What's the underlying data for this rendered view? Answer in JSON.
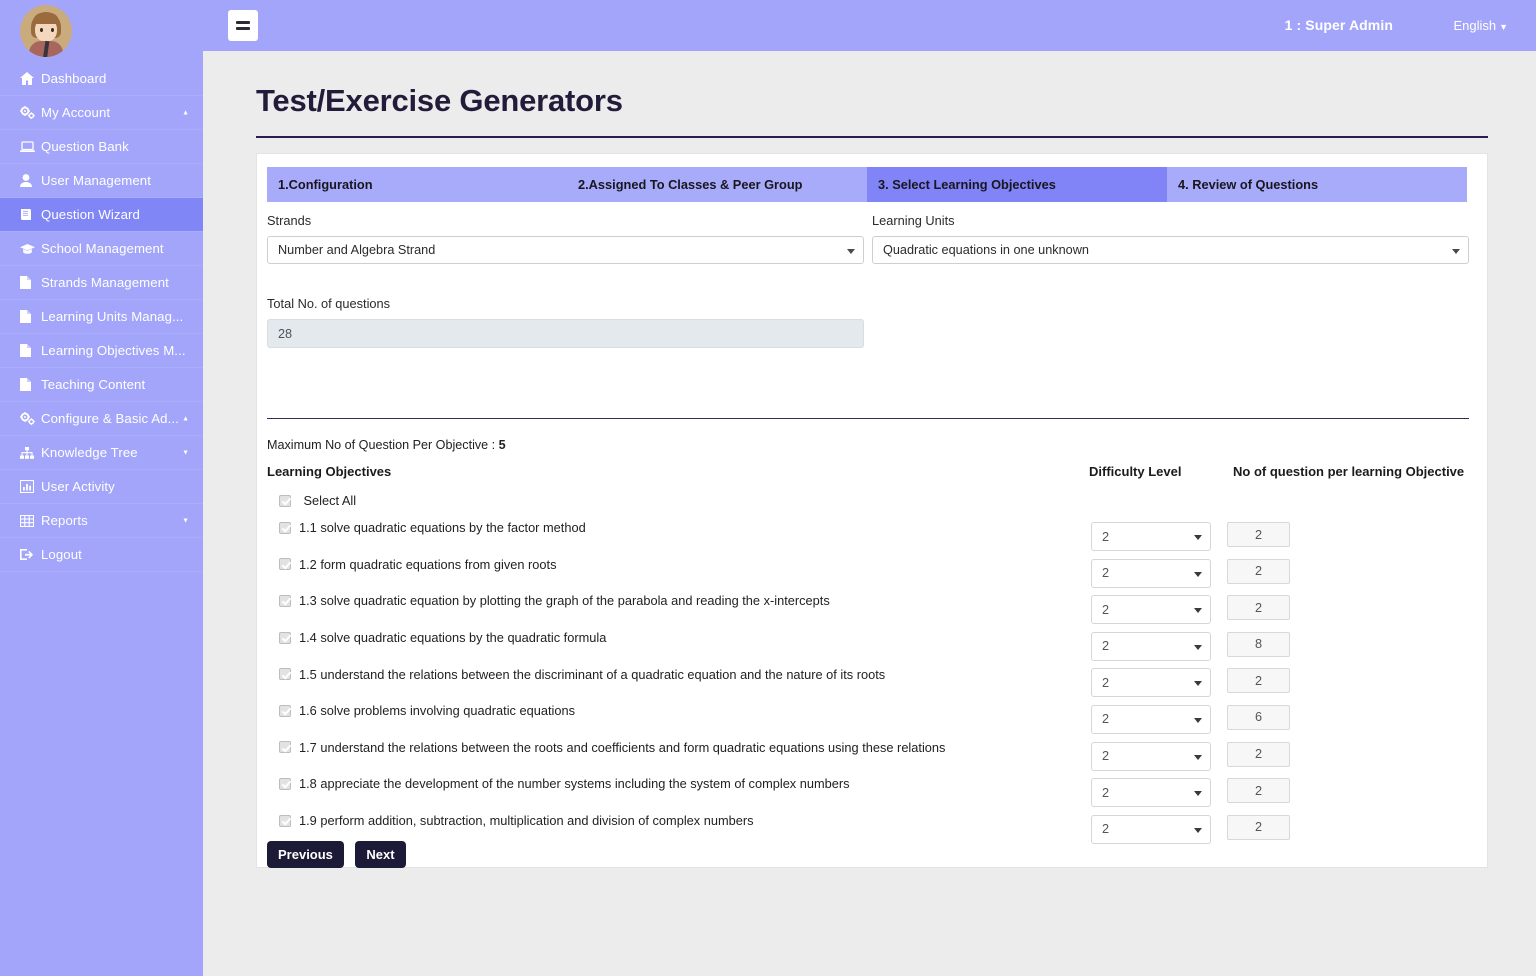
{
  "sidebar": {
    "avatar_name": "user-avatar",
    "items": [
      {
        "label": "Dashboard",
        "icon": "home-icon",
        "caret": ""
      },
      {
        "label": "My Account",
        "icon": "gears-icon",
        "caret": "up"
      },
      {
        "label": "Question Bank",
        "icon": "laptop-icon",
        "caret": ""
      },
      {
        "label": "User Management",
        "icon": "user-icon",
        "caret": ""
      },
      {
        "label": "Question Wizard",
        "icon": "book-icon",
        "caret": "",
        "active": true
      },
      {
        "label": "School Management",
        "icon": "graduation-icon",
        "caret": ""
      },
      {
        "label": "Strands Management",
        "icon": "file-icon",
        "caret": ""
      },
      {
        "label": "Learning Units Manag...",
        "icon": "file-icon",
        "caret": ""
      },
      {
        "label": "Learning Objectives M...",
        "icon": "file-icon",
        "caret": ""
      },
      {
        "label": "Teaching Content",
        "icon": "file-icon",
        "caret": ""
      },
      {
        "label": "Configure & Basic Ad...",
        "icon": "gears-icon",
        "caret": "up"
      },
      {
        "label": "Knowledge Tree",
        "icon": "sitemap-icon",
        "caret": "down"
      },
      {
        "label": "User Activity",
        "icon": "chart-icon",
        "caret": ""
      },
      {
        "label": "Reports",
        "icon": "table-icon",
        "caret": "down"
      },
      {
        "label": "Logout",
        "icon": "logout-icon",
        "caret": ""
      }
    ]
  },
  "header": {
    "menu_toggle": "hamburger-menu",
    "user": "1 : Super Admin",
    "language": "English"
  },
  "page": {
    "title": "Test/Exercise Generators"
  },
  "stepper": {
    "steps": [
      {
        "label": "1.Configuration",
        "active": false
      },
      {
        "label": "2.Assigned To Classes & Peer Group",
        "active": false
      },
      {
        "label": "3. Select Learning Objectives",
        "active": true
      },
      {
        "label": "4. Review of Questions",
        "active": false
      }
    ]
  },
  "form": {
    "strands_label": "Strands",
    "strands_value": "Number and Algebra Strand",
    "learning_units_label": "Learning Units",
    "learning_units_value": "Quadratic equations in one unknown",
    "total_questions_label": "Total No. of questions",
    "total_questions_value": "28"
  },
  "objectives": {
    "max_per_objective_text": "Maximum No of Question Per Objective : ",
    "max_per_objective_value": "5",
    "col_objectives": "Learning Objectives",
    "col_difficulty": "Difficulty Level",
    "col_count": "No of question per learning Objective",
    "select_all_label": "Select All",
    "rows": [
      {
        "label": "1.1 solve quadratic equations by the factor method",
        "difficulty": "2",
        "count": "2",
        "checked": true
      },
      {
        "label": "1.2 form quadratic equations from given roots",
        "difficulty": "2",
        "count": "2",
        "checked": true
      },
      {
        "label": "1.3 solve quadratic equation by plotting the graph of the parabola and reading the x-intercepts",
        "difficulty": "2",
        "count": "2",
        "checked": true
      },
      {
        "label": "1.4 solve quadratic equations by the quadratic formula",
        "difficulty": "2",
        "count": "8",
        "checked": true
      },
      {
        "label": "1.5 understand the relations between the discriminant of a quadratic equation and the nature of its roots",
        "difficulty": "2",
        "count": "2",
        "checked": true
      },
      {
        "label": "1.6 solve problems involving quadratic equations",
        "difficulty": "2",
        "count": "6",
        "checked": true
      },
      {
        "label": "1.7 understand the relations between the roots and coefficients and form quadratic equations using these relations",
        "difficulty": "2",
        "count": "2",
        "checked": true
      },
      {
        "label": "1.8 appreciate the development of the number systems including the system of complex numbers",
        "difficulty": "2",
        "count": "2",
        "checked": true
      },
      {
        "label": "1.9 perform addition, subtraction, multiplication and division of complex numbers",
        "difficulty": "2",
        "count": "2",
        "checked": true
      }
    ]
  },
  "actions": {
    "previous": "Previous",
    "next": "Next"
  },
  "colors": {
    "sidebar": "#a2a5f9",
    "header": "#a2a5f9",
    "step_inactive": "#a8abfa",
    "step_active": "#8084f6",
    "button": "#1b1b38",
    "page_bg": "#ececec"
  }
}
